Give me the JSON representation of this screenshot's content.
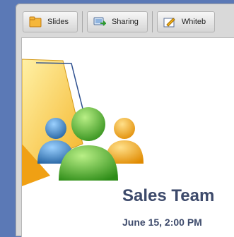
{
  "toolbar": {
    "tabs": [
      {
        "label": "Slides",
        "icon": "slides-folder-icon"
      },
      {
        "label": "Sharing",
        "icon": "sharing-icon"
      },
      {
        "label": "Whiteb",
        "icon": "whiteboard-icon"
      }
    ]
  },
  "slide": {
    "title": "Sales Team",
    "subtitle": "June 15, 2:00 PM"
  },
  "colors": {
    "background": "#5b79b6",
    "title_text": "#3d4a6b",
    "person_green": "#3fa31f",
    "person_blue": "#2f7fc0",
    "person_orange": "#f0a11a",
    "folder_yellow": "#f6c23d"
  }
}
